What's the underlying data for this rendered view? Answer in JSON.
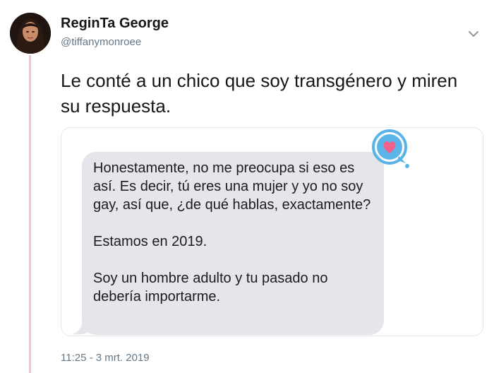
{
  "user": {
    "display_name": "ReginTa George",
    "handle": "@tiffanymonroee"
  },
  "tweet": {
    "text": "Le conté a un chico que soy transgénero y miren su respuesta.",
    "timestamp": "11:25 - 3 mrt. 2019"
  },
  "media": {
    "message_text": "Honestamente, no me preocupa si eso es así. Es decir, tú eres una mujer y yo no soy gay, así que, ¿de qué hablas, exactamente?\n\nEstamos en 2019.\n\nSoy un hombre adulto y tu pasado no debería importarme.",
    "badge_icon": "heart-speech-bubble-icon"
  },
  "icons": {
    "menu": "chevron-down-icon"
  },
  "colors": {
    "thread_line": "#f4c4d2",
    "bubble": "#e6e5eb",
    "badge_blue": "#5ab4e8",
    "heart": "#f0628c",
    "secondary_text": "#657786"
  }
}
